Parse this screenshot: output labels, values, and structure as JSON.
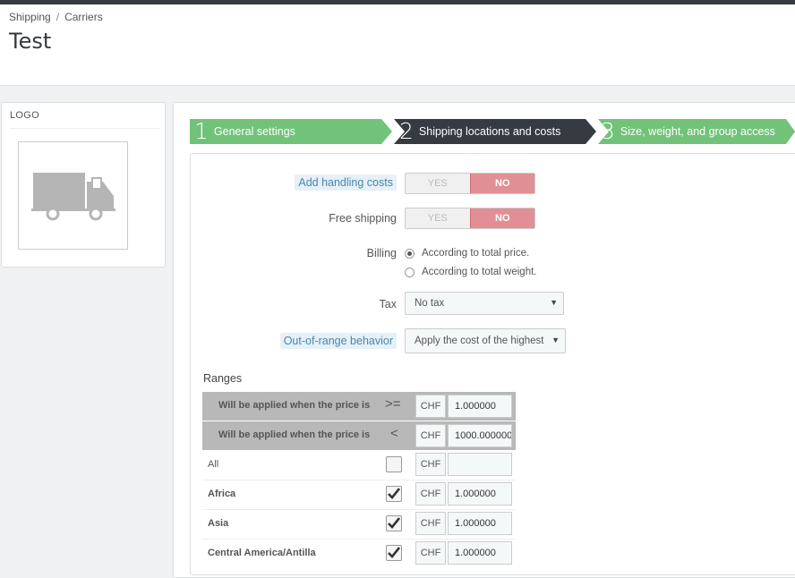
{
  "breadcrumb": {
    "items": [
      "Shipping",
      "Carriers"
    ],
    "separator": "/"
  },
  "page": {
    "title": "Test"
  },
  "logo_panel": {
    "heading": "LOGO",
    "image_icon": "truck-icon"
  },
  "wizard": {
    "steps": [
      {
        "number": "1",
        "label": "General settings",
        "state": "done"
      },
      {
        "number": "2",
        "label": "Shipping locations and costs",
        "state": "active"
      },
      {
        "number": "3",
        "label": "Size, weight, and group access",
        "state": "todo"
      }
    ]
  },
  "form": {
    "handling_costs": {
      "label": "Add handling costs",
      "yes": "YES",
      "no": "NO",
      "selected": "NO"
    },
    "free_shipping": {
      "label": "Free shipping",
      "yes": "YES",
      "no": "NO",
      "selected": "NO"
    },
    "billing": {
      "label": "Billing",
      "options": [
        "According to total price.",
        "According to total weight."
      ],
      "selected": "According to total price."
    },
    "tax": {
      "label": "Tax",
      "value": "No tax"
    },
    "out_of_range": {
      "label": "Out-of-range behavior",
      "value": "Apply the cost of the highest"
    }
  },
  "ranges": {
    "title": "Ranges",
    "lower": {
      "text": "Will be applied when the price is",
      "operator": ">=",
      "currency": "CHF",
      "value": "1.000000"
    },
    "upper": {
      "text": "Will be applied when the price is",
      "operator": "<",
      "currency": "CHF",
      "value": "1000.000000"
    },
    "zones": [
      {
        "name": "All",
        "checked": false,
        "currency": "CHF",
        "value": ""
      },
      {
        "name": "Africa",
        "checked": true,
        "currency": "CHF",
        "value": "1.000000"
      },
      {
        "name": "Asia",
        "checked": true,
        "currency": "CHF",
        "value": "1.000000"
      },
      {
        "name": "Central America/Antilla",
        "checked": true,
        "currency": "CHF",
        "value": "1.000000"
      }
    ]
  },
  "colors": {
    "step_done": "#72c279",
    "step_active": "#363a41",
    "switch_no": "#e08f95",
    "hint_text": "#4a86b3"
  }
}
